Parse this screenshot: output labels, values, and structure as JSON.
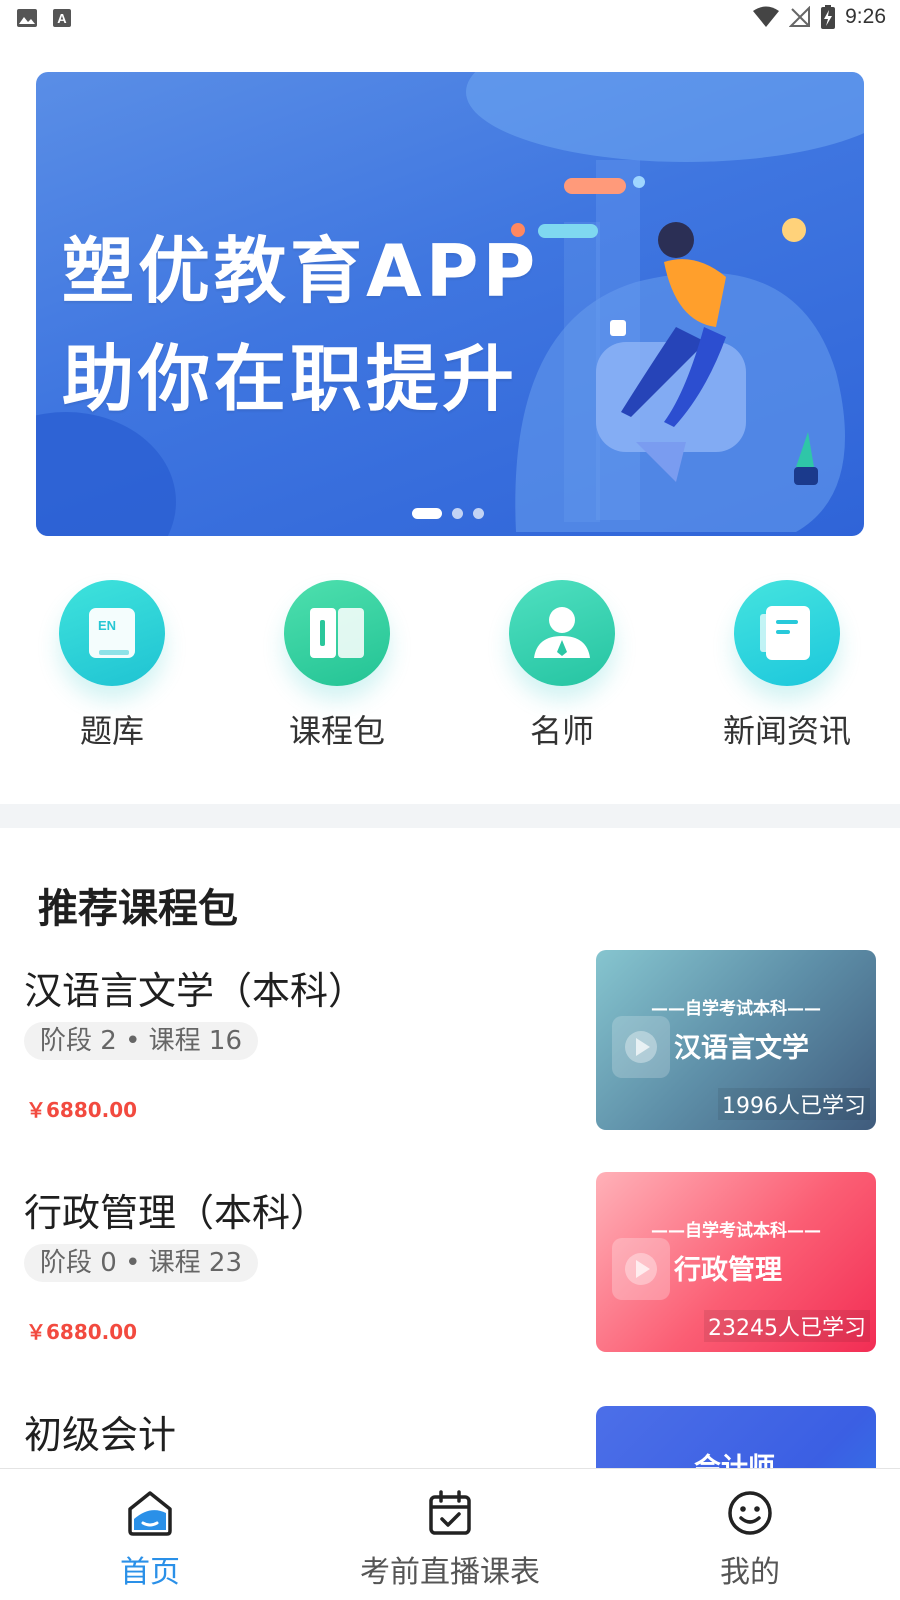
{
  "status_bar": {
    "time": "9:26",
    "left_icons": [
      "image-icon",
      "text-a-icon"
    ],
    "right_icons": [
      "wifi-icon",
      "no-signal-icon",
      "battery-charging-icon"
    ]
  },
  "banner": {
    "line1": "塑优教育APP",
    "line2": "助你在职提升",
    "page_count": 3,
    "active_page": 1
  },
  "quick_nav": [
    {
      "label": "题库",
      "icon": "en-book-icon"
    },
    {
      "label": "课程包",
      "icon": "open-book-icon"
    },
    {
      "label": "名师",
      "icon": "teacher-icon"
    },
    {
      "label": "新闻资讯",
      "icon": "document-icon"
    }
  ],
  "recommended": {
    "title": "推荐课程包",
    "courses": [
      {
        "title": "汉语言文学（本科）",
        "meta": "阶段 2 • 课程 16",
        "price": "￥6880.00",
        "thumb_sub": "——自学考试本科——",
        "thumb_main": "汉语言文学",
        "thumb_count": "1996人已学习"
      },
      {
        "title": "行政管理（本科）",
        "meta": "阶段 0 • 课程 23",
        "price": "￥6880.00",
        "thumb_sub": "——自学考试本科——",
        "thumb_main": "行政管理",
        "thumb_count": "23245人已学习"
      },
      {
        "title": "初级会计",
        "thumb_main": "会计师"
      }
    ]
  },
  "tab_bar": {
    "tabs": [
      {
        "label": "首页",
        "icon": "home-icon",
        "active": true
      },
      {
        "label": "考前直播课表",
        "icon": "calendar-check-icon",
        "active": false
      },
      {
        "label": "我的",
        "icon": "smiley-icon",
        "active": false
      }
    ],
    "active_color": "#2a90e8"
  },
  "colors": {
    "banner_blue": "#3f76e0",
    "price_red": "#f24a3f",
    "teal": "#1fc3d3"
  }
}
